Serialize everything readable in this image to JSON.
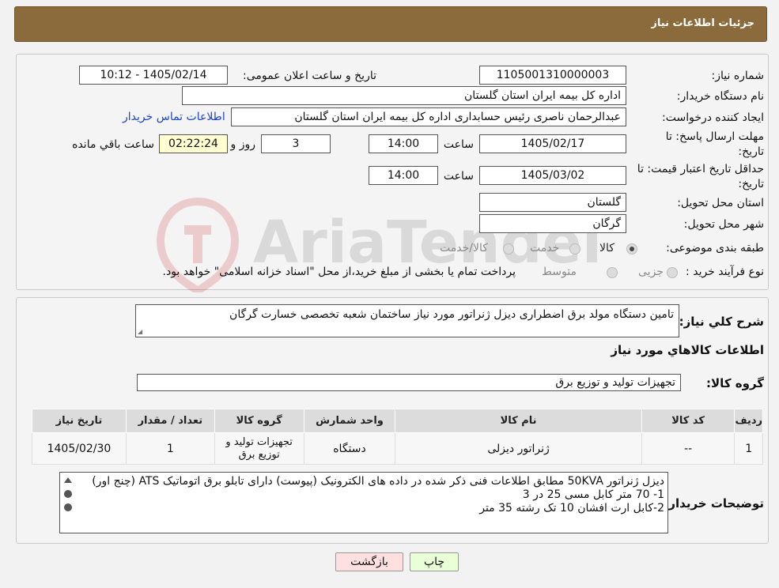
{
  "header": {
    "title": "جزئیات اطلاعات نیاز"
  },
  "form": {
    "need_number_label": "شماره نیاز:",
    "need_number": "1105001310000003",
    "announce_label": "تاریخ و ساعت اعلان عمومی:",
    "announce_value": "1405/02/14 - 10:12",
    "buyer_org_label": "نام دستگاه خریدار:",
    "buyer_org": "اداره کل بیمه ایران استان گلستان",
    "creator_label": "ایجاد کننده درخواست:",
    "creator": "عبدالرحمان ناصری رئیس حسابداری اداره کل بیمه ایران استان گلستان",
    "contact_link": "اطلاعات تماس خریدار",
    "reply_deadline_label": "مهلت ارسال پاسخ: تا تاریخ:",
    "reply_date": "1405/02/17",
    "time_label": "ساعت",
    "reply_time": "14:00",
    "days_value": "3",
    "days_label": "روز و",
    "remaining_time": "02:22:24",
    "remaining_label": "ساعت باقي مانده",
    "validity_label": "حداقل تاریخ اعتبار قیمت: تا تاریخ:",
    "validity_date": "1405/03/02",
    "validity_time": "14:00",
    "province_label": "استان محل تحویل:",
    "province": "گلستان",
    "city_label": "شهر محل تحویل:",
    "city": "گرگان",
    "category_label": "طبقه بندی موضوعی:",
    "category_options": [
      "کالا",
      "خدمت",
      "کالا/خدمت"
    ],
    "category_selected": "کالا",
    "purchase_label": "نوع فرآیند خرید :",
    "purchase_options": [
      "جزیی",
      "متوسط"
    ],
    "purchase_note": "پرداخت تمام یا بخشی از مبلغ خرید،از محل \"اسناد خزانه اسلامی\" خواهد بود."
  },
  "summary": {
    "label": "شرح کلي نیاز:",
    "value": "تامین دستگاه مولد برق اضطراری دیزل ژنراتور مورد نیاز ساختمان شعبه تخصصی خسارت گرگان",
    "goods_info_title": "اطلاعات کالاهاي مورد نیاز",
    "goods_group_label": "گروه کالا:",
    "goods_group": "تجهیزات تولید و توزیع برق"
  },
  "table": {
    "headers": [
      "ردیف",
      "کد کالا",
      "نام کالا",
      "واحد شمارش",
      "گروه کالا",
      "تعداد / مقدار",
      "تاریخ نیاز"
    ],
    "rows": [
      [
        "1",
        "--",
        "ژنراتور دیزلی",
        "دستگاه",
        "تجهیزات تولید و توزیع برق",
        "1",
        "1405/02/30"
      ]
    ]
  },
  "buyer_notes": {
    "label": "توضیحات خریدار:",
    "lines": [
      "دیزل ژنراتور 50KVA مطابق اطلاعات فنی ذکر شده در داده های الکترونیک (پیوست) دارای تابلو برق اتوماتیک ATS (چنج اور)",
      "1- 70 متر کابل مسی 25 در 3",
      "2-کابل ارت افشان 10 تک رشته 35 متر"
    ]
  },
  "buttons": {
    "print": "چاپ",
    "back": "بازگشت"
  },
  "watermark": {
    "text": "AriaTender.neT"
  },
  "colors": {
    "header": "#8b6a3b",
    "link": "#1a44c7",
    "back_button": "#ffe0e0",
    "print_button": "#e8ffd8",
    "yellow_box": "#ffffd2"
  }
}
